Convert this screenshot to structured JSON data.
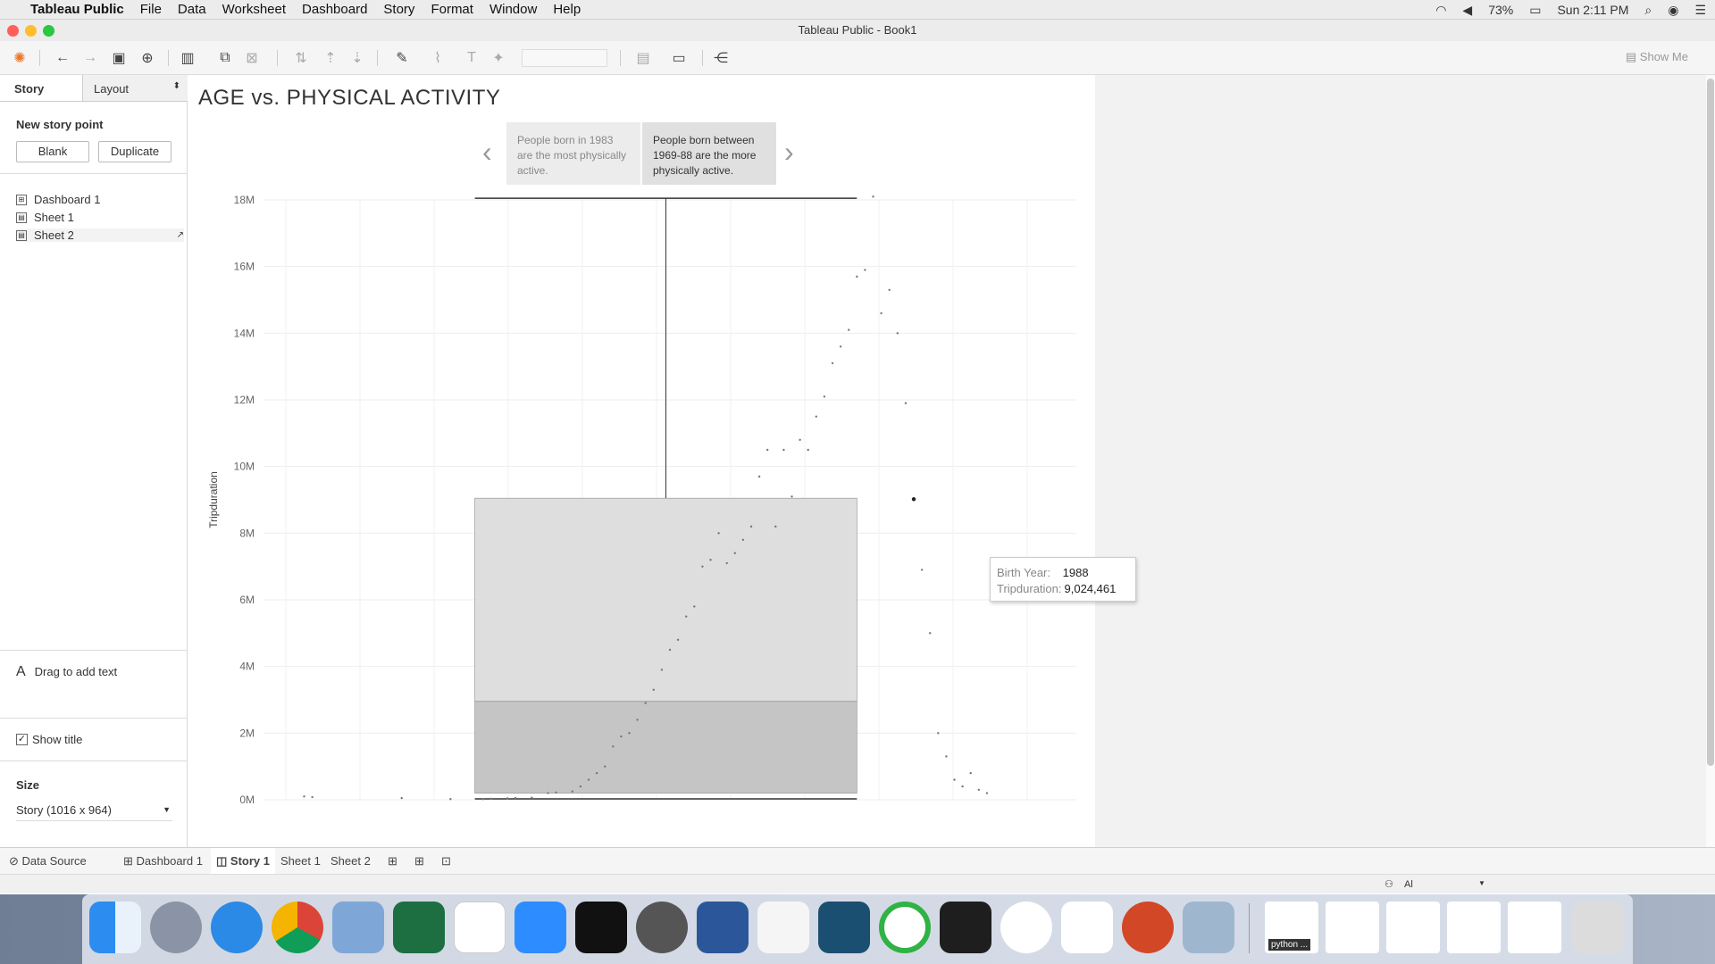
{
  "menubar": {
    "app_name": "Tableau Public",
    "menus": [
      "File",
      "Data",
      "Worksheet",
      "Dashboard",
      "Story",
      "Format",
      "Window",
      "Help"
    ],
    "battery": "73%",
    "clock": "Sun 2:11 PM"
  },
  "window": {
    "title": "Tableau Public - Book1"
  },
  "toolbar": {
    "show_me": "Show Me"
  },
  "left_panel": {
    "tab_story": "Story",
    "tab_layout": "Layout",
    "new_story_point": "New story point",
    "blank": "Blank",
    "duplicate": "Duplicate",
    "sheets": [
      "Dashboard 1",
      "Sheet 1",
      "Sheet 2"
    ],
    "drag_text": "Drag to add text",
    "show_title": "Show title",
    "size_label": "Size",
    "size_value": "Story (1016 x 964)"
  },
  "story": {
    "title": "AGE vs. PHYSICAL ACTIVITY",
    "points": [
      "People born in 1983 are the most physically active.",
      "People born between 1969-88 are the more physically active."
    ],
    "active_point": 1
  },
  "tooltip": {
    "birth_year_label": "Birth Year:",
    "birth_year_value": "1988",
    "tripduration_label": "Tripduration:",
    "tripduration_value": "9,024,461"
  },
  "chart_data": {
    "type": "scatter",
    "ylabel": "Tripduration",
    "yticks": [
      "0M",
      "2M",
      "4M",
      "6M",
      "8M",
      "10M",
      "12M",
      "14M",
      "16M",
      "18M"
    ],
    "ylim": [
      0,
      18000000
    ],
    "grid": true,
    "boxplot": {
      "lower_hinge": 200000,
      "median": 2950000,
      "upper_hinge": 9050000,
      "upper_whisker": 18050000,
      "lower_whisker": 0
    },
    "points": [
      [
        0.05,
        0.1
      ],
      [
        0.06,
        0.08
      ],
      [
        0.17,
        0.05
      ],
      [
        0.23,
        0.02
      ],
      [
        0.27,
        0.02
      ],
      [
        0.28,
        0.03
      ],
      [
        0.3,
        0.04
      ],
      [
        0.31,
        0.05
      ],
      [
        0.33,
        0.06
      ],
      [
        0.35,
        0.2
      ],
      [
        0.36,
        0.22
      ],
      [
        0.38,
        0.25
      ],
      [
        0.39,
        0.4
      ],
      [
        0.4,
        0.6
      ],
      [
        0.41,
        0.8
      ],
      [
        0.42,
        1.0
      ],
      [
        0.43,
        1.6
      ],
      [
        0.44,
        1.9
      ],
      [
        0.45,
        2.0
      ],
      [
        0.46,
        2.4
      ],
      [
        0.47,
        2.9
      ],
      [
        0.48,
        3.3
      ],
      [
        0.49,
        3.9
      ],
      [
        0.5,
        4.5
      ],
      [
        0.51,
        4.8
      ],
      [
        0.52,
        5.5
      ],
      [
        0.53,
        5.8
      ],
      [
        0.54,
        7.0
      ],
      [
        0.55,
        7.2
      ],
      [
        0.56,
        8.0
      ],
      [
        0.57,
        7.1
      ],
      [
        0.58,
        7.4
      ],
      [
        0.59,
        7.8
      ],
      [
        0.6,
        8.2
      ],
      [
        0.61,
        9.7
      ],
      [
        0.62,
        10.5
      ],
      [
        0.63,
        8.2
      ],
      [
        0.64,
        10.5
      ],
      [
        0.65,
        9.1
      ],
      [
        0.66,
        10.8
      ],
      [
        0.67,
        10.5
      ],
      [
        0.68,
        11.5
      ],
      [
        0.69,
        12.1
      ],
      [
        0.7,
        13.1
      ],
      [
        0.71,
        13.6
      ],
      [
        0.72,
        14.1
      ],
      [
        0.73,
        15.7
      ],
      [
        0.74,
        15.9
      ],
      [
        0.75,
        18.1
      ],
      [
        0.76,
        14.6
      ],
      [
        0.77,
        15.3
      ],
      [
        0.78,
        14.0
      ],
      [
        0.79,
        11.9
      ],
      [
        0.8,
        9.02
      ],
      [
        0.81,
        6.9
      ],
      [
        0.82,
        5.0
      ],
      [
        0.83,
        2.0
      ],
      [
        0.84,
        1.3
      ],
      [
        0.85,
        0.6
      ],
      [
        0.86,
        0.4
      ],
      [
        0.87,
        0.8
      ],
      [
        0.88,
        0.3
      ],
      [
        0.89,
        0.2
      ]
    ]
  },
  "bottom_tabs": [
    "Data Source",
    "Dashboard 1",
    "Story 1",
    "Sheet 1",
    "Sheet 2"
  ],
  "status": {
    "user": "Al"
  },
  "dock": {
    "label_python": "python ..."
  }
}
